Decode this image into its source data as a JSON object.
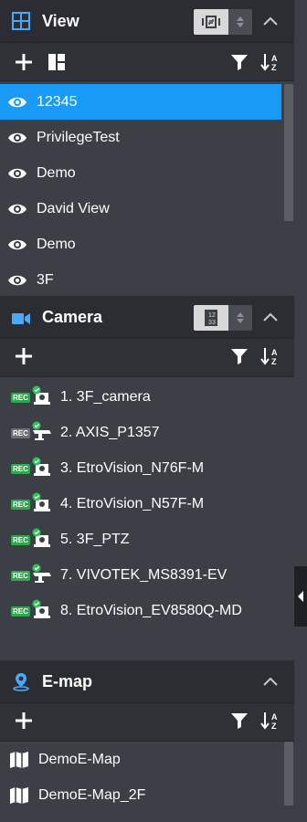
{
  "view": {
    "title": "View",
    "items": [
      {
        "label": "12345",
        "selected": true
      },
      {
        "label": "PrivilegeTest",
        "selected": false
      },
      {
        "label": "Demo",
        "selected": false
      },
      {
        "label": "David View",
        "selected": false
      },
      {
        "label": "Demo",
        "selected": false
      },
      {
        "label": "3F",
        "selected": false
      }
    ]
  },
  "camera": {
    "title": "Camera",
    "rec_label": "REC",
    "items": [
      {
        "label": "1. 3F_camera",
        "recording": true,
        "type": "dome"
      },
      {
        "label": "2. AXIS_P1357",
        "recording": false,
        "type": "bullet"
      },
      {
        "label": "3. EtroVision_N76F-M",
        "recording": true,
        "type": "dome"
      },
      {
        "label": "4. EtroVision_N57F-M",
        "recording": true,
        "type": "dome"
      },
      {
        "label": "5. 3F_PTZ",
        "recording": true,
        "type": "dome"
      },
      {
        "label": "7. VIVOTEK_MS8391-EV",
        "recording": true,
        "type": "bullet"
      },
      {
        "label": "8. EtroVision_EV8580Q-MD",
        "recording": true,
        "type": "dome"
      }
    ]
  },
  "emap": {
    "title": "E-map",
    "items": [
      {
        "label": "DemoE-Map"
      },
      {
        "label": "DemoE-Map_2F"
      }
    ]
  },
  "colors": {
    "selected": "#1a9af7",
    "accent_icon": "#4aa8ff",
    "rec_on": "#2fa84f",
    "online_badge": "#2fc25b"
  },
  "icons": {
    "view": "grid-icon",
    "camera": "video-camera-icon",
    "emap": "map-pin-icon",
    "add": "plus-icon",
    "layout": "layout-icon",
    "filter": "filter-icon",
    "sort": "sort-az-icon",
    "eye": "eye-icon",
    "map": "map-icon"
  }
}
